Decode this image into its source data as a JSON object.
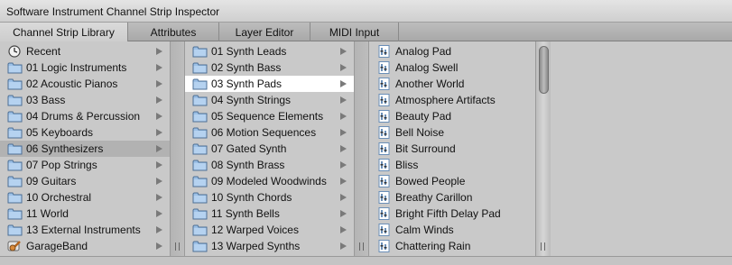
{
  "window": {
    "title": "Software Instrument Channel Strip Inspector"
  },
  "tabs": [
    {
      "label": "Channel Strip Library",
      "active": true
    },
    {
      "label": "Attributes",
      "active": false
    },
    {
      "label": "Layer Editor",
      "active": false
    },
    {
      "label": "MIDI Input",
      "active": false
    }
  ],
  "column1": {
    "items": [
      {
        "label": "Recent",
        "icon": "clock-icon"
      },
      {
        "label": "01 Logic Instruments",
        "icon": "folder-icon"
      },
      {
        "label": "02 Acoustic Pianos",
        "icon": "folder-icon"
      },
      {
        "label": "03 Bass",
        "icon": "folder-icon"
      },
      {
        "label": "04 Drums & Percussion",
        "icon": "folder-icon"
      },
      {
        "label": "05 Keyboards",
        "icon": "folder-icon"
      },
      {
        "label": "06 Synthesizers",
        "icon": "folder-icon",
        "selected": true
      },
      {
        "label": "07 Pop Strings",
        "icon": "folder-icon"
      },
      {
        "label": "09 Guitars",
        "icon": "folder-icon"
      },
      {
        "label": "10 Orchestral",
        "icon": "folder-icon"
      },
      {
        "label": "11 World",
        "icon": "folder-icon"
      },
      {
        "label": "13 External Instruments",
        "icon": "folder-icon"
      },
      {
        "label": "GarageBand",
        "icon": "garageband-icon"
      }
    ]
  },
  "column2": {
    "items": [
      {
        "label": "01 Synth Leads",
        "icon": "folder-icon"
      },
      {
        "label": "02 Synth Bass",
        "icon": "folder-icon"
      },
      {
        "label": "03 Synth Pads",
        "icon": "folder-icon",
        "selected": true
      },
      {
        "label": "04 Synth Strings",
        "icon": "folder-icon"
      },
      {
        "label": "05 Sequence Elements",
        "icon": "folder-icon"
      },
      {
        "label": "06 Motion Sequences",
        "icon": "folder-icon"
      },
      {
        "label": "07 Gated Synth",
        "icon": "folder-icon"
      },
      {
        "label": "08 Synth Brass",
        "icon": "folder-icon"
      },
      {
        "label": "09 Modeled Woodwinds",
        "icon": "folder-icon"
      },
      {
        "label": "10 Synth Chords",
        "icon": "folder-icon"
      },
      {
        "label": "11 Synth Bells",
        "icon": "folder-icon"
      },
      {
        "label": "12 Warped Voices",
        "icon": "folder-icon"
      },
      {
        "label": "13 Warped Synths",
        "icon": "folder-icon"
      }
    ]
  },
  "column3": {
    "items": [
      {
        "label": "Analog Pad",
        "icon": "channel-strip-file-icon"
      },
      {
        "label": "Analog Swell",
        "icon": "channel-strip-file-icon"
      },
      {
        "label": "Another World",
        "icon": "channel-strip-file-icon"
      },
      {
        "label": "Atmosphere Artifacts",
        "icon": "channel-strip-file-icon"
      },
      {
        "label": "Beauty Pad",
        "icon": "channel-strip-file-icon"
      },
      {
        "label": "Bell Noise",
        "icon": "channel-strip-file-icon"
      },
      {
        "label": "Bit Surround",
        "icon": "channel-strip-file-icon"
      },
      {
        "label": "Bliss",
        "icon": "channel-strip-file-icon"
      },
      {
        "label": "Bowed People",
        "icon": "channel-strip-file-icon"
      },
      {
        "label": "Breathy Carillon",
        "icon": "channel-strip-file-icon"
      },
      {
        "label": "Bright Fifth Delay Pad",
        "icon": "channel-strip-file-icon"
      },
      {
        "label": "Calm Winds",
        "icon": "channel-strip-file-icon"
      },
      {
        "label": "Chattering Rain",
        "icon": "channel-strip-file-icon"
      }
    ]
  },
  "colors": {
    "selected_grey": "#b2b2b2",
    "selected_white": "#ffffff",
    "folder_blue": "#9cc0e6"
  }
}
